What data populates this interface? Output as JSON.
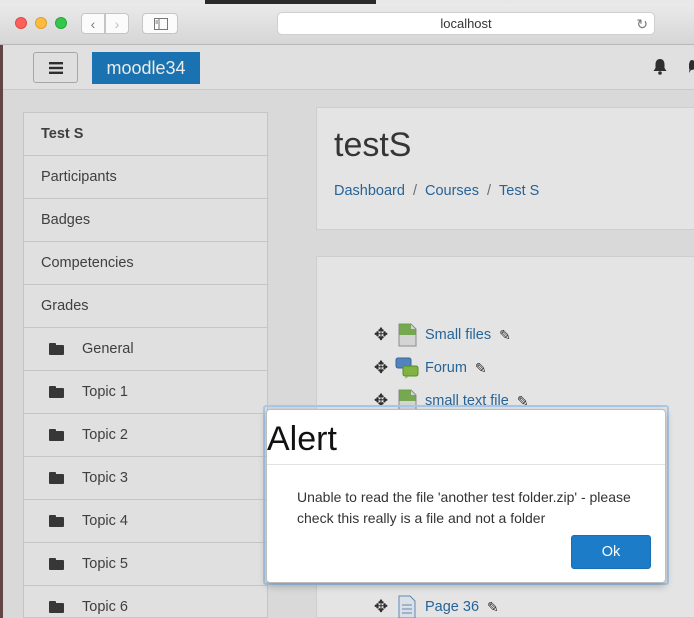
{
  "browser": {
    "url": "localhost"
  },
  "navbar": {
    "brand": "moodle34"
  },
  "drawer": {
    "items": [
      {
        "label": "Test S"
      },
      {
        "label": "Participants"
      },
      {
        "label": "Badges"
      },
      {
        "label": "Competencies"
      },
      {
        "label": "Grades"
      },
      {
        "label": "General"
      },
      {
        "label": "Topic 1"
      },
      {
        "label": "Topic 2"
      },
      {
        "label": "Topic 3"
      },
      {
        "label": "Topic 4"
      },
      {
        "label": "Topic 5"
      },
      {
        "label": "Topic 6"
      }
    ]
  },
  "header": {
    "title": "testS",
    "breadcrumb": [
      "Dashboard",
      "Courses",
      "Test S"
    ],
    "separator": "/"
  },
  "content": {
    "activities": [
      {
        "label": "Small files",
        "icon": "file-icon"
      },
      {
        "label": "Forum",
        "icon": "forum-icon"
      },
      {
        "label": "small text file",
        "icon": "file-icon"
      },
      {
        "label": "Page 36",
        "icon": "page-icon"
      }
    ]
  },
  "dialog": {
    "title": "Alert",
    "message": "Unable to read the file 'another test folder.zip' - please check this really is a file and not a folder",
    "ok_label": "Ok"
  }
}
